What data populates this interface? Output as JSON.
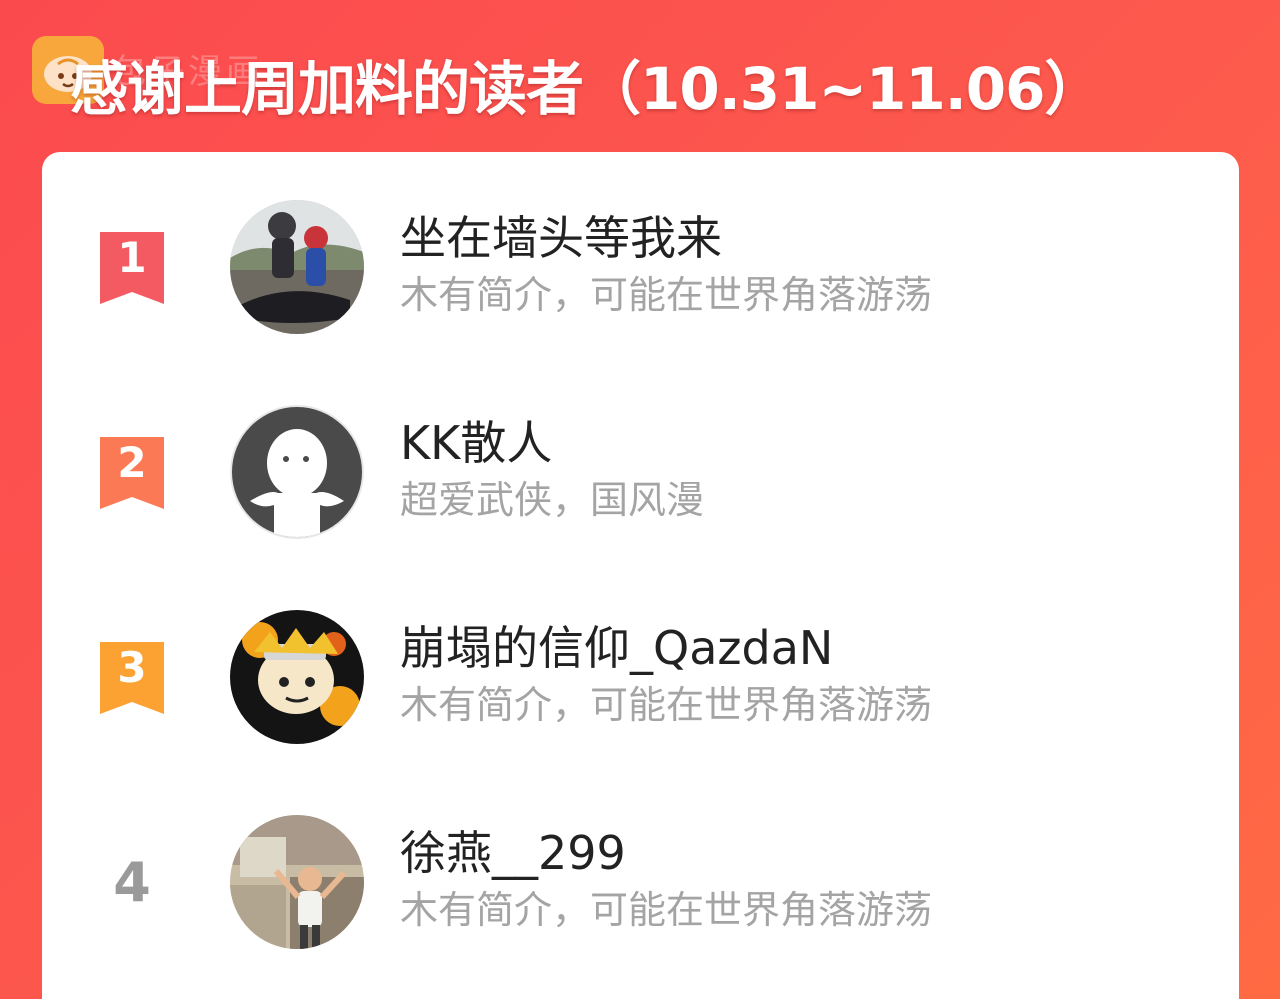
{
  "header": {
    "title": "感谢上周加料的读者（10.31~11.06）",
    "watermark": "包子漫画"
  },
  "colors": {
    "background_start": "#fb4a4e",
    "background_end": "#ff6a43",
    "rank1": "#f45a62",
    "rank2": "#fb7a55",
    "rank3": "#fba233",
    "rank_plain": "#9a9a9a"
  },
  "readers": [
    {
      "rank": "1",
      "name": "坐在墙头等我来",
      "bio": "木有简介，可能在世界角落游荡",
      "avatar": "photo-motorcycle-riders"
    },
    {
      "rank": "2",
      "name": "KK散人",
      "bio": "超爱武侠，国风漫",
      "avatar": "default-ghost-avatar"
    },
    {
      "rank": "3",
      "name": "崩塌的信仰_QazdaN",
      "bio": "木有简介，可能在世界角落游荡",
      "avatar": "anime-ninja-avatar"
    },
    {
      "rank": "4",
      "name": "徐燕__299",
      "bio": "木有简介，可能在世界角落游荡",
      "avatar": "photo-child"
    }
  ]
}
